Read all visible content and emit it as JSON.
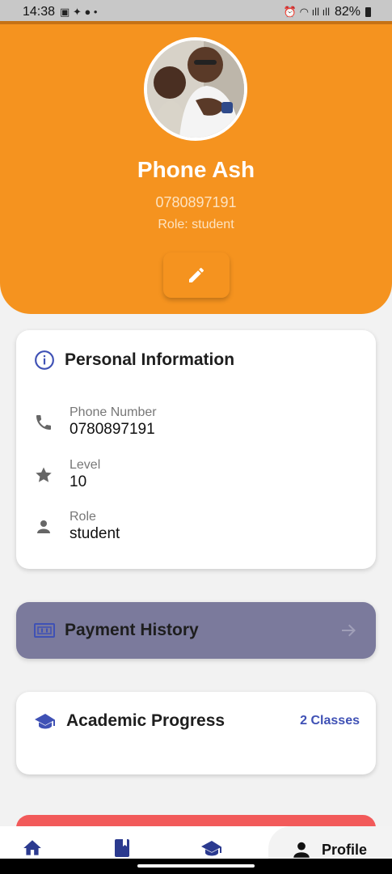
{
  "status_bar": {
    "time": "14:38",
    "left_symbols": "▣ ✦ ● •",
    "right_symbols": "⏰ ◠ ıll ıll",
    "battery": "82%"
  },
  "profile": {
    "name": "Phone Ash",
    "phone": "0780897191",
    "role_line": "Role: student"
  },
  "personal_info": {
    "title": "Personal Information",
    "rows": [
      {
        "icon": "phone-icon",
        "label": "Phone Number",
        "value": "0780897191"
      },
      {
        "icon": "star-icon",
        "label": "Level",
        "value": "10"
      },
      {
        "icon": "person-icon",
        "label": "Role",
        "value": "student"
      }
    ]
  },
  "payment": {
    "title": "Payment History",
    "icon": "money-icon"
  },
  "academic": {
    "title": "Academic Progress",
    "classes": "2 Classes",
    "icon": "graduation-cap-icon"
  },
  "bottom_nav": {
    "items": [
      {
        "icon": "home-icon"
      },
      {
        "icon": "book-icon"
      },
      {
        "icon": "graduation-cap-icon"
      },
      {
        "icon": "person-icon",
        "label": "Profile"
      }
    ]
  },
  "colors": {
    "header": "#f5931f",
    "accent": "#3f51b5",
    "payment_card": "#7b7a9c",
    "danger": "#f25a5a"
  }
}
